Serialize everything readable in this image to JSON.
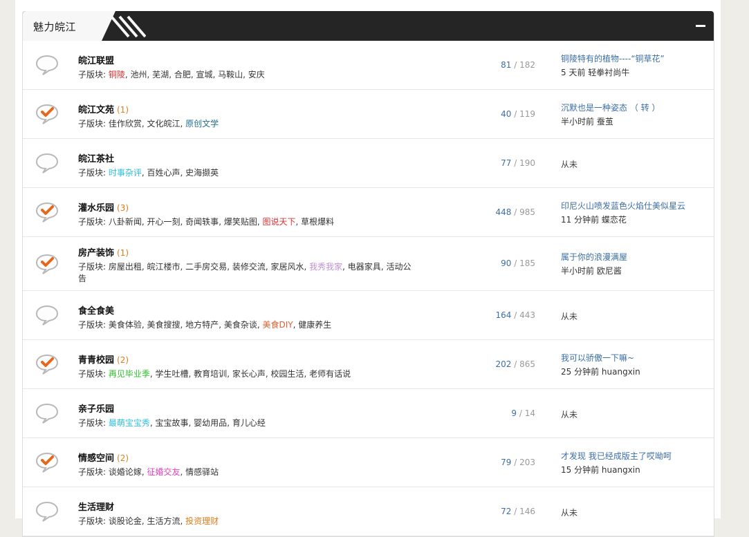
{
  "section": {
    "title": "魅力皖江",
    "subforum_prefix": "子版块: "
  },
  "forums": [
    {
      "name": "皖江联盟",
      "new_count": "",
      "icon": "bubble-icon",
      "subforums": [
        {
          "label": "铜陵",
          "color": "#e03030"
        },
        {
          "label": "池州",
          "color": ""
        },
        {
          "label": "芜湖",
          "color": ""
        },
        {
          "label": "合肥",
          "color": ""
        },
        {
          "label": "宣城",
          "color": ""
        },
        {
          "label": "马鞍山",
          "color": ""
        },
        {
          "label": "安庆",
          "color": ""
        }
      ],
      "threads": "81",
      "posts": "182",
      "last_title": "铜陵特有的植物----“铜草花”",
      "last_time": "5 天前",
      "last_user": "轻拳衬尚牛"
    },
    {
      "name": "皖江文苑",
      "new_count": "(1)",
      "icon": "bubble-check-icon",
      "subforums": [
        {
          "label": "佳作欣赏",
          "color": ""
        },
        {
          "label": "文化皖江",
          "color": ""
        },
        {
          "label": "原创文学",
          "color": "#1f6f8b"
        }
      ],
      "threads": "40",
      "posts": "119",
      "last_title": "沉默也是一种姿态 （ 转 ）",
      "last_time": "半小时前",
      "last_user": "蚕茧"
    },
    {
      "name": "皖江茶社",
      "new_count": "",
      "icon": "bubble-icon",
      "subforums": [
        {
          "label": "时事杂评",
          "color": "#2ec0e0"
        },
        {
          "label": "百姓心声",
          "color": ""
        },
        {
          "label": "史海撷英",
          "color": ""
        }
      ],
      "threads": "77",
      "posts": "190",
      "last_title": "",
      "last_time": "",
      "last_user": "",
      "never": "从未"
    },
    {
      "name": "灌水乐园",
      "new_count": "(3)",
      "icon": "bubble-check-icon",
      "subforums": [
        {
          "label": "八卦新闻",
          "color": ""
        },
        {
          "label": "开心一刻",
          "color": ""
        },
        {
          "label": "奇闻轶事",
          "color": ""
        },
        {
          "label": "爆笑贴图",
          "color": ""
        },
        {
          "label": "图说天下",
          "color": "#e03030"
        },
        {
          "label": "草根爆料",
          "color": ""
        }
      ],
      "threads": "448",
      "posts": "985",
      "last_title": "印尼火山喷发蓝色火焰仕美似星云",
      "last_time": "11 分钟前",
      "last_user": "蝶恋花"
    },
    {
      "name": "房产装饰",
      "new_count": "(1)",
      "icon": "bubble-check-icon",
      "subforums": [
        {
          "label": "房屋出租",
          "color": ""
        },
        {
          "label": "皖江楼市",
          "color": ""
        },
        {
          "label": "二手房交易",
          "color": ""
        },
        {
          "label": "装修交流",
          "color": ""
        },
        {
          "label": "家居风水",
          "color": ""
        },
        {
          "label": "我秀我家",
          "color": "#c090d0"
        },
        {
          "label": "电器家具",
          "color": ""
        },
        {
          "label": "活动公告",
          "color": ""
        }
      ],
      "threads": "90",
      "posts": "185",
      "last_title": "属于你的浪漫满屋",
      "last_time": "半小时前",
      "last_user": "欧尼酱"
    },
    {
      "name": "食全食美",
      "new_count": "",
      "icon": "bubble-icon",
      "subforums": [
        {
          "label": "美食体验",
          "color": ""
        },
        {
          "label": "美食搜搜",
          "color": ""
        },
        {
          "label": "地方特产",
          "color": ""
        },
        {
          "label": "美食杂谈",
          "color": ""
        },
        {
          "label": "美食DIY",
          "color": "#e06030"
        },
        {
          "label": "健康养生",
          "color": ""
        }
      ],
      "threads": "164",
      "posts": "443",
      "last_title": "",
      "last_time": "",
      "last_user": "",
      "never": "从未"
    },
    {
      "name": "青青校园",
      "new_count": "(2)",
      "icon": "bubble-check-icon",
      "subforums": [
        {
          "label": "再见毕业季",
          "color": "#30c030"
        },
        {
          "label": "学生吐槽",
          "color": ""
        },
        {
          "label": "教育培训",
          "color": ""
        },
        {
          "label": "家长心声",
          "color": ""
        },
        {
          "label": "校园生活",
          "color": ""
        },
        {
          "label": "老师有话说",
          "color": ""
        }
      ],
      "threads": "202",
      "posts": "865",
      "last_title": "我可以骄傲一下嘛~",
      "last_time": "25 分钟前",
      "last_user": "huangxin"
    },
    {
      "name": "亲子乐园",
      "new_count": "",
      "icon": "bubble-icon",
      "subforums": [
        {
          "label": "最萌宝宝秀",
          "color": "#2ec0e0"
        },
        {
          "label": "宝宝故事",
          "color": ""
        },
        {
          "label": "婴幼用品",
          "color": ""
        },
        {
          "label": "育儿心经",
          "color": ""
        }
      ],
      "threads": "9",
      "posts": "14",
      "last_title": "",
      "last_time": "",
      "last_user": "",
      "never": "从未"
    },
    {
      "name": "情感空间",
      "new_count": "(2)",
      "icon": "bubble-check-icon",
      "subforums": [
        {
          "label": "谈婚论嫁",
          "color": ""
        },
        {
          "label": "征婚交友",
          "color": "#e040c0"
        },
        {
          "label": "情感驿站",
          "color": ""
        }
      ],
      "threads": "79",
      "posts": "203",
      "last_title": "才发现 我已经成版主了哎呦呵",
      "last_time": "15 分钟前",
      "last_user": "huangxin"
    },
    {
      "name": "生活理财",
      "new_count": "",
      "icon": "bubble-icon",
      "subforums": [
        {
          "label": "谈股论金",
          "color": ""
        },
        {
          "label": "生活方流",
          "color": ""
        },
        {
          "label": "投资理财",
          "color": "#e07b1a"
        }
      ],
      "threads": "72",
      "posts": "146",
      "last_title": "",
      "last_time": "",
      "last_user": "",
      "never": "从未"
    }
  ]
}
